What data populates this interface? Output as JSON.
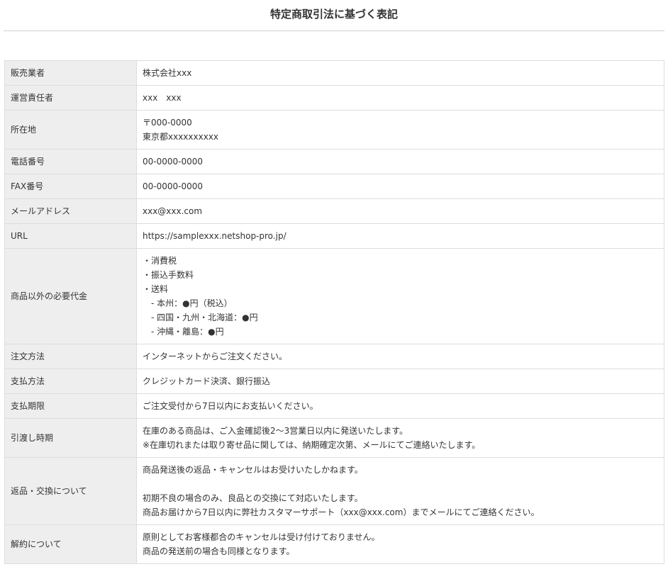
{
  "page_title": "特定商取引法に基づく表記",
  "rows": [
    {
      "label": "販売業者",
      "value": "株式会社xxx"
    },
    {
      "label": "運営責任者",
      "value": "xxx　xxx"
    },
    {
      "label": "所在地",
      "value": "〒000-0000\n東京都xxxxxxxxxx"
    },
    {
      "label": "電話番号",
      "value": "00-0000-0000"
    },
    {
      "label": "FAX番号",
      "value": "00-0000-0000"
    },
    {
      "label": "メールアドレス",
      "value": "xxx@xxx.com"
    },
    {
      "label": "URL",
      "value": "https://samplexxx.netshop-pro.jp/"
    },
    {
      "label": "商品以外の必要代金",
      "value": "・消費税\n・振込手数料\n・送料\n　- 本州：●円（税込）\n　- 四国・九州・北海道：●円\n　- 沖縄・離島：●円"
    },
    {
      "label": "注文方法",
      "value": "インターネットからご注文ください。"
    },
    {
      "label": "支払方法",
      "value": "クレジットカード決済、銀行振込"
    },
    {
      "label": "支払期限",
      "value": "ご注文受付から7日以内にお支払いください。"
    },
    {
      "label": "引渡し時期",
      "value": "在庫のある商品は、ご入金確認後2〜3営業日以内に発送いたします。\n※在庫切れまたは取り寄せ品に関しては、納期確定次第、メールにてご連絡いたします。"
    },
    {
      "label": "返品・交換について",
      "value": "商品発送後の返品・キャンセルはお受けいたしかねます。\n\n初期不良の場合のみ、良品との交換にて対応いたします。\n商品お届けから7日以内に弊社カスタマーサポート（xxx@xxx.com）までメールにてご連絡ください。"
    },
    {
      "label": "解約について",
      "value": "原則としてお客様都合のキャンセルは受け付けておりません。\n商品の発送前の場合も同様となります。"
    }
  ]
}
